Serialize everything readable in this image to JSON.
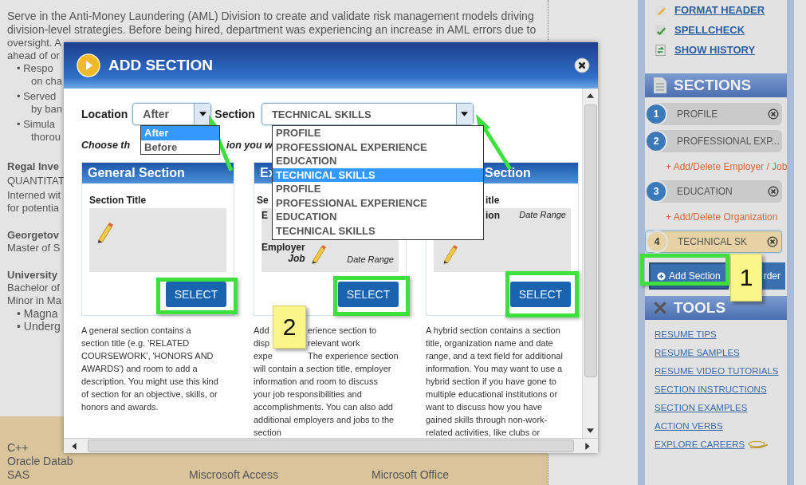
{
  "resume": {
    "intro_lines": [
      "Serve in the Anti-Money Laundering (AML) Division to create and validate risk management models driving",
      "division-level strategies. Before being hired, department was experiencing an increase in AML errors due to"
    ],
    "fragments": [
      {
        "kind": "text",
        "text": "oversight. A"
      },
      {
        "kind": "text",
        "text": "ahead of or"
      },
      {
        "kind": "bullet",
        "text": "• Respo"
      },
      {
        "kind": "cont",
        "text": "on cha"
      },
      {
        "kind": "bullet",
        "text": "• Served"
      },
      {
        "kind": "cont",
        "text": "by ban"
      },
      {
        "kind": "bullet",
        "text": "• Simula"
      },
      {
        "kind": "cont",
        "text": "thorou"
      },
      {
        "kind": "org",
        "text": "Regal Inve"
      },
      {
        "kind": "plain",
        "text": "QUANTITAT"
      },
      {
        "kind": "plain",
        "text": "Interned wit"
      },
      {
        "kind": "cont0",
        "text": "for potentia"
      },
      {
        "kind": "org",
        "text": "Georgetov"
      },
      {
        "kind": "cont0",
        "text": "Master of S"
      },
      {
        "kind": "org",
        "text": "University"
      },
      {
        "kind": "cont0",
        "text": "Bachelor of"
      },
      {
        "kind": "cont0",
        "text": "Minor in Ma"
      },
      {
        "kind": "bullet2",
        "text": "• Magna"
      },
      {
        "kind": "bullet2",
        "text": "• Underg"
      }
    ],
    "skills_columns": [
      [
        "C++",
        "Oracle Datab",
        "SAS"
      ],
      [
        "Miscrosoft Access"
      ],
      [
        "Microsoft Office"
      ]
    ]
  },
  "dialog": {
    "title": "ADD SECTION",
    "location_label": "Location",
    "location_value": "After",
    "location_options": [
      {
        "label": "After",
        "selected": true
      },
      {
        "label": "Before",
        "selected": false
      }
    ],
    "section_label": "Section",
    "section_value": "TECHNICAL SKILLS",
    "section_options": [
      {
        "label": "PROFILE",
        "selected": false
      },
      {
        "label": "PROFESSIONAL EXPERIENCE",
        "selected": false
      },
      {
        "label": "EDUCATION",
        "selected": false
      },
      {
        "label": "TECHNICAL SKILLS",
        "selected": true
      },
      {
        "label": "PROFILE",
        "selected": false
      },
      {
        "label": "PROFESSIONAL EXPERIENCE",
        "selected": false
      },
      {
        "label": "EDUCATION",
        "selected": false
      },
      {
        "label": "TECHNICAL SKILLS",
        "selected": false
      }
    ],
    "instruction_parts": [
      "Choose th",
      "ion you w"
    ],
    "cards": [
      {
        "kind": "general",
        "heading": "General Section",
        "preview": [
          "Section Title"
        ],
        "button": "SELECT",
        "lines": [
          [
            "A general section contains a"
          ],
          [
            "section title (e.g. 'RELATED"
          ],
          [
            "COURSEWORK', 'HONORS AND"
          ],
          [
            "AWARDS') and room to add a"
          ],
          [
            "description. You might use this kind"
          ],
          [
            "of section for an objective, skills, or"
          ],
          [
            "honors and awards."
          ]
        ]
      },
      {
        "kind": "experience",
        "heading": "Ex",
        "preview": [
          "Se",
          "E",
          "Employer",
          "Job",
          "Date Range"
        ],
        "button": "SELECT",
        "lines": [
          [
            "Add",
            "erience section to"
          ],
          [
            "disp",
            "relevant work"
          ],
          [
            "expe",
            "The experience section"
          ],
          [
            "will contain a section title, employer"
          ],
          [
            "information and room to discuss"
          ],
          [
            "your job responsibilities and"
          ],
          [
            "accomplishments. You can also add"
          ],
          [
            "additional employers and jobs to the"
          ],
          [
            "section"
          ]
        ]
      },
      {
        "kind": "hybrid",
        "heading": "Section",
        "preview": [
          "itle",
          "ion",
          "Date Range"
        ],
        "button": "SELECT",
        "lines": [
          [
            "A hybrid section contains a section"
          ],
          [
            "title, organization name and date"
          ],
          [
            "range, and a text field for additional"
          ],
          [
            "information. You may want to use a"
          ],
          [
            "hybrid section if you have gone to"
          ],
          [
            "multiple educational institutions or"
          ],
          [
            "want to discuss how you have"
          ],
          [
            "gained skills through non-work-"
          ],
          [
            "related activities, like clubs or"
          ]
        ]
      }
    ]
  },
  "sidebar": {
    "links": [
      "FORMAT HEADER",
      "SPELLCHECK",
      "SHOW HISTORY"
    ],
    "sections_title": "SECTIONS",
    "sections": [
      {
        "number": "1",
        "label": "PROFILE",
        "selected": false
      },
      {
        "number": "2",
        "label": "PROFESSIONAL EXP...",
        "selected": false,
        "sublink": "+ Add/Delete Employer / Job"
      },
      {
        "number": "3",
        "label": "EDUCATION",
        "selected": false,
        "sublink": "+ Add/Delete Organization"
      },
      {
        "number": "4",
        "label": "TECHNICAL SK",
        "selected": true
      }
    ],
    "add_button": "Add Section",
    "reorder_button": "rder",
    "tools_title": "TOOLS",
    "tools": [
      "RESUME TIPS",
      "RESUME SAMPLES",
      "RESUME VIDEO TUTORIALS",
      "SECTION INSTRUCTIONS",
      "SECTION EXAMPLES",
      "ACTION VERBS",
      "EXPLORE CAREERS"
    ]
  },
  "callouts": [
    {
      "label": "2"
    },
    {
      "label": "1"
    }
  ]
}
